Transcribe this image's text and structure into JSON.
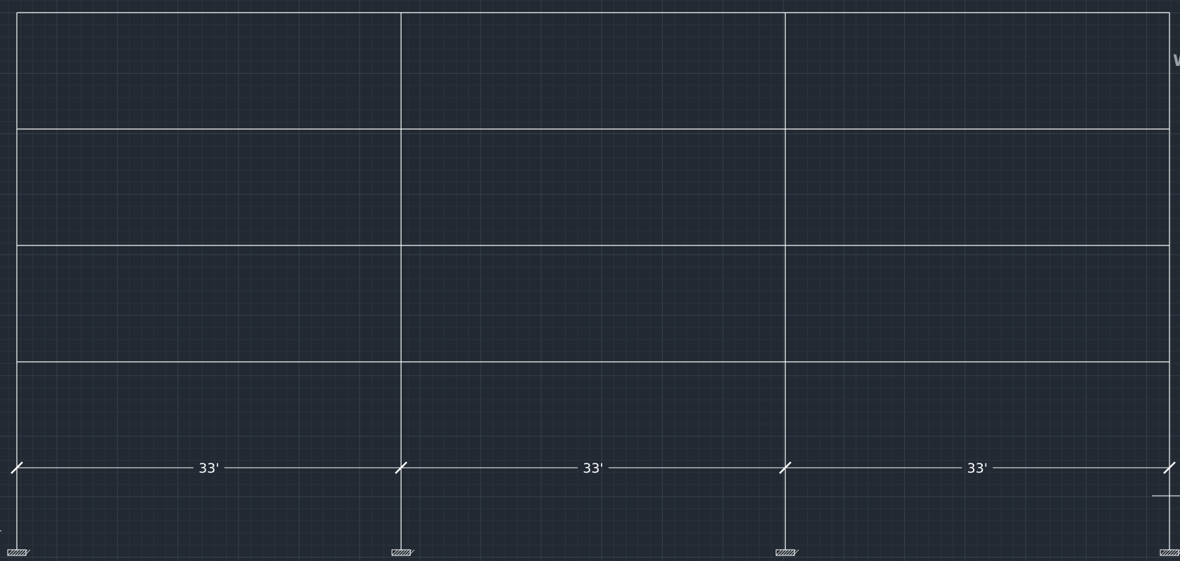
{
  "drawing": {
    "background_color": "#222933",
    "grid_minor_color": "#2b333d",
    "grid_major_color": "#36404b",
    "line_color": "#ffffff",
    "edge_label": "W"
  },
  "frame": {
    "spans": [
      {
        "label": "33'"
      },
      {
        "label": "33'"
      },
      {
        "label": "33'"
      }
    ],
    "stories": 4
  }
}
